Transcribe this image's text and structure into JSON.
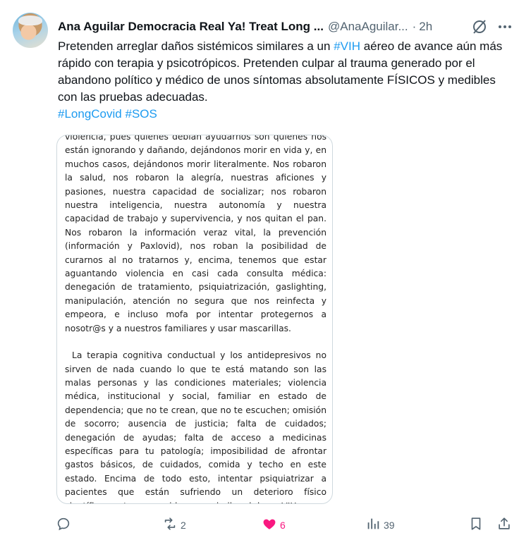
{
  "author": {
    "display_name": "Ana Aguilar Democracia Real Ya! Treat Long ...",
    "handle": "@AnaAguilar...",
    "separator": "·",
    "time": "2h"
  },
  "post": {
    "text_part1": "Pretenden arreglar daños sistémicos similares a un ",
    "hashtag_vih": "#VIH",
    "text_part2": " aéreo de avance aún más rápido con terapia y psicotrópicos. Pretenden culpar al trauma generado por el abandono político y médico de unos síntomas absolutamente FÍSICOS y medibles con las pruebas adecuadas.",
    "hashtag_longcovid": "#LongCovid",
    "hashtag_sos": "#SOS"
  },
  "media": {
    "paragraph1": "violencia, pues quienes debían ayudarnos son quienes nos están ignorando y dañando, dejándonos morir en vida y, en muchos casos, dejándonos morir literalmente. Nos robaron la salud, nos robaron la alegría, nuestras aficiones y pasiones, nuestra capacidad de socializar; nos robaron nuestra inteligencia, nuestra autonomía y nuestra capacidad de trabajo y supervivencia, y nos quitan el pan. Nos robaron la información veraz vital, la prevención (información y Paxlovid), nos roban la posibilidad de curarnos al no tratarnos y, encima, tenemos que estar aguantando violencia en casi cada consulta médica: denegación de tratamiento, psiquiatrización, gaslighting, manipulación, atención no segura que nos reinfecta y empeora, e incluso mofa por intentar protegernos a nosotr@s y a nuestros familiares y usar mascarillas.",
    "paragraph2": "La terapia cognitiva conductual y los antidepresivos no sirven de nada cuando lo que te está matando son las malas personas y las condiciones materiales; violencia médica, institucional y social, familiar en estado de dependencia; que no te crean, que no te escuchen; omisión de socorro; ausencia de justicia; falta de cuidados; denegación de ayudas; falta de acceso a medicinas específicas para tu patología; imposibilidad de afrontar gastos básicos, de cuidados, comida y techo en este estado. Encima de todo esto, intentar psiquiatrizar a pacientes que están sufriendo un deterioro físico científicamente reconocido como similar al de un VIH"
  },
  "actions": {
    "reposts": "2",
    "likes": "6",
    "views": "39"
  },
  "colors": {
    "link": "#1d9bf0",
    "muted": "#536471",
    "like": "#f91880"
  },
  "icons": [
    "grok-icon",
    "more-icon",
    "reply-icon",
    "repost-icon",
    "like-icon",
    "views-icon",
    "bookmark-icon",
    "share-icon"
  ]
}
